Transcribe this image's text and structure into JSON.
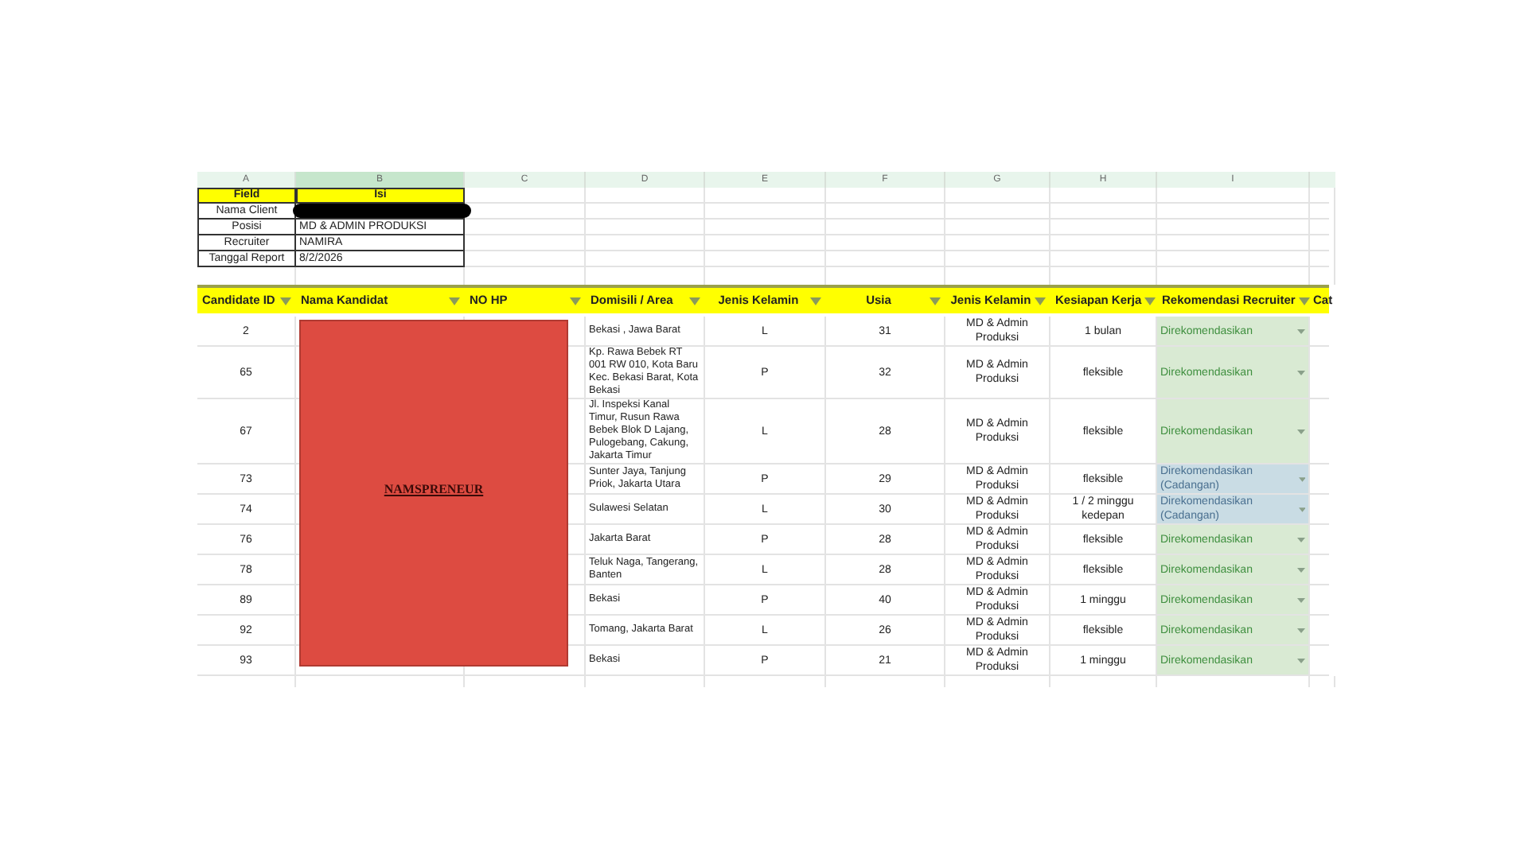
{
  "column_letters": [
    {
      "label": "A",
      "selected": false
    },
    {
      "label": "B",
      "selected": true
    },
    {
      "label": "C",
      "selected": false
    },
    {
      "label": "D",
      "selected": false
    },
    {
      "label": "E",
      "selected": false
    },
    {
      "label": "F",
      "selected": false
    },
    {
      "label": "G",
      "selected": false
    },
    {
      "label": "H",
      "selected": false
    },
    {
      "label": "I",
      "selected": false
    }
  ],
  "info_table": {
    "header": [
      "Field",
      "Isi"
    ],
    "rows": [
      {
        "field": "Nama Client"
      },
      {
        "field": "Posisi",
        "value": "MD & ADMIN PRODUKSI"
      },
      {
        "field": "Recruiter",
        "value": "NAMIRA"
      },
      {
        "field": "Tanggal Report",
        "value": "8/2/2026"
      }
    ]
  },
  "table": {
    "columns": [
      "Candidate ID",
      "Nama Kandidat",
      "NO HP",
      "Domisili / Area",
      "Jenis Kelamin",
      "Usia",
      "Jenis Kelamin",
      "Kesiapan Kerja",
      "Rekomendasi Recruiter",
      "Cat"
    ],
    "rows": [
      {
        "id": "2",
        "area": "Bekasi , Jawa Barat",
        "gender": "L",
        "age": "31",
        "position": "MD & Admin Produksi",
        "readiness": "1 bulan",
        "recommendation": "Direkomendasikan",
        "kind": "recommended"
      },
      {
        "id": "65",
        "area": "Kp. Rawa Bebek RT 001 RW 010, Kota Baru Kec. Bekasi Barat, Kota Bekasi",
        "gender": "P",
        "age": "32",
        "position": "MD & Admin Produksi",
        "readiness": "fleksible",
        "recommendation": "Direkomendasikan",
        "kind": "recommended"
      },
      {
        "id": "67",
        "area": "Jl. Inspeksi Kanal Timur, Rusun Rawa Bebek Blok D Lajang, Pulogebang, Cakung, Jakarta Timur",
        "gender": "L",
        "age": "28",
        "position": "MD & Admin Produksi",
        "readiness": "fleksible",
        "recommendation": "Direkomendasikan",
        "kind": "recommended"
      },
      {
        "id": "73",
        "area": "Sunter Jaya, Tanjung Priok, Jakarta Utara",
        "gender": "P",
        "age": "29",
        "position": "MD & Admin Produksi",
        "readiness": "fleksible",
        "recommendation": "Direkomendasikan (Cadangan)",
        "kind": "reserve"
      },
      {
        "id": "74",
        "area": "Sulawesi Selatan",
        "gender": "L",
        "age": "30",
        "position": "MD & Admin Produksi",
        "readiness": "1 / 2 minggu kedepan",
        "recommendation": "Direkomendasikan (Cadangan)",
        "kind": "reserve"
      },
      {
        "id": "76",
        "area": "Jakarta Barat",
        "gender": "P",
        "age": "28",
        "position": "MD & Admin Produksi",
        "readiness": "fleksible",
        "recommendation": "Direkomendasikan",
        "kind": "recommended"
      },
      {
        "id": "78",
        "area": "Teluk Naga, Tangerang, Banten",
        "gender": "L",
        "age": "28",
        "position": "MD & Admin Produksi",
        "readiness": "fleksible",
        "recommendation": "Direkomendasikan",
        "kind": "recommended"
      },
      {
        "id": "89",
        "area": "Bekasi",
        "gender": "P",
        "age": "40",
        "position": "MD & Admin Produksi",
        "readiness": "1 minggu",
        "recommendation": "Direkomendasikan",
        "kind": "recommended"
      },
      {
        "id": "92",
        "area": "Tomang, Jakarta Barat",
        "gender": "L",
        "age": "26",
        "position": "MD & Admin Produksi",
        "readiness": "fleksible",
        "recommendation": "Direkomendasikan",
        "kind": "recommended"
      },
      {
        "id": "93",
        "area": "Bekasi",
        "gender": "P",
        "age": "21",
        "position": "MD & Admin Produksi",
        "readiness": "1 minggu",
        "recommendation": "Direkomendasikan",
        "kind": "recommended"
      }
    ]
  },
  "redaction": {
    "text": "NAMSPRENEUR"
  }
}
